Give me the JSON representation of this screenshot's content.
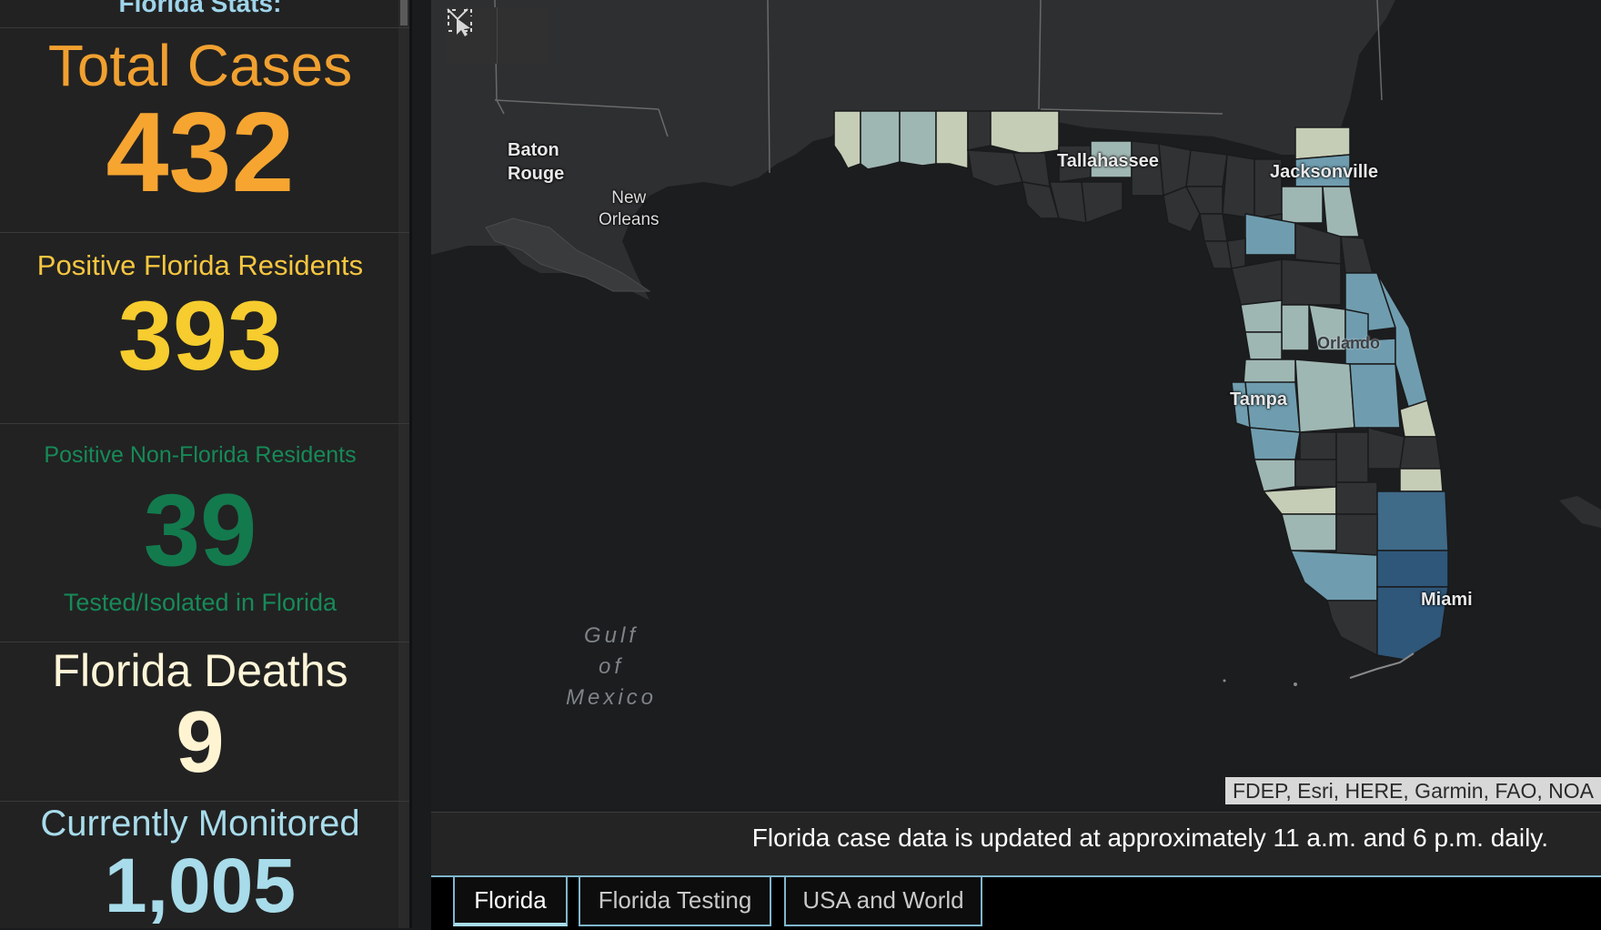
{
  "sidebar": {
    "title": "Florida Stats:",
    "total_cases": {
      "label": "Total Cases",
      "value": "432"
    },
    "residents": {
      "label": "Positive Florida Residents",
      "value": "393"
    },
    "non_residents": {
      "label": "Positive Non-Florida Residents",
      "value": "39",
      "sublabel": "Tested/Isolated in Florida"
    },
    "deaths": {
      "label": "Florida Deaths",
      "value": "9"
    },
    "monitored": {
      "label": "Currently Monitored",
      "value": "1,005"
    }
  },
  "map": {
    "tools": [
      {
        "name": "select-tool-icon"
      },
      {
        "name": "chevron-down-icon"
      }
    ],
    "places": {
      "baton_rouge_1": "Baton",
      "baton_rouge_2": "Rouge",
      "new_orleans_1": "New",
      "new_orleans_2": "Orleans",
      "tallahassee": "Tallahassee",
      "jacksonville": "Jacksonville",
      "orlando": "Orlando",
      "tampa": "Tampa",
      "miami": "Miami"
    },
    "gulf": [
      "Gulf",
      "of",
      "Mexico"
    ],
    "attribution": "FDEP, Esri, HERE, Garmin, FAO, NOA",
    "colors": {
      "land": "#2c2d2f",
      "water": "#1c1d1f",
      "zero_cases": "#303234",
      "low": "#c6cdb6",
      "mid": "#9fb7b3",
      "high": "#6f9daf",
      "highest": "#3c6286"
    }
  },
  "footer": {
    "update_note": "Florida case data is updated at approximately 11 a.m. and 6 p.m. daily."
  },
  "tabs": [
    {
      "label": "Florida",
      "active": true
    },
    {
      "label": "Florida Testing",
      "active": false
    },
    {
      "label": "USA and World",
      "active": false
    }
  ]
}
